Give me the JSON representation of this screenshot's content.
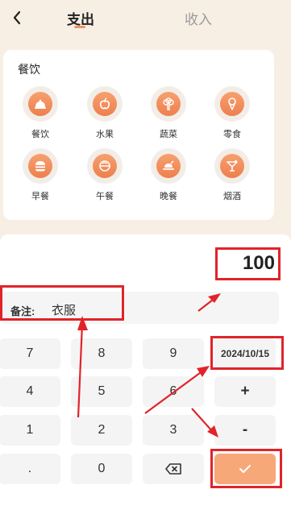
{
  "header": {
    "back_icon": "chevron-left-icon",
    "tabs": [
      {
        "label": "支出",
        "active": true
      },
      {
        "label": "收入",
        "active": false
      }
    ]
  },
  "category_panel": {
    "title": "餐饮",
    "items": [
      {
        "label": "餐饮",
        "icon": "cloche-icon"
      },
      {
        "label": "水果",
        "icon": "apple-icon"
      },
      {
        "label": "蔬菜",
        "icon": "broccoli-icon"
      },
      {
        "label": "零食",
        "icon": "ice-cream-icon"
      },
      {
        "label": "早餐",
        "icon": "burger-icon"
      },
      {
        "label": "午餐",
        "icon": "bowl-icon"
      },
      {
        "label": "晚餐",
        "icon": "roast-chicken-icon"
      },
      {
        "label": "烟酒",
        "icon": "cocktail-icon"
      }
    ]
  },
  "amount": "100",
  "note": {
    "label": "备注:",
    "value": "衣服"
  },
  "keypad": {
    "rows": [
      [
        "7",
        "8",
        "9",
        "2024/10/15"
      ],
      [
        "4",
        "5",
        "6",
        "+"
      ],
      [
        "1",
        "2",
        "3",
        "-"
      ],
      [
        ".",
        "0",
        "backspace-icon",
        "confirm-check-icon"
      ]
    ]
  },
  "colors": {
    "accent": "#f0946a",
    "confirm_button": "#f7a878",
    "background": "#f8efe4",
    "annotation_red": "#e0242a"
  }
}
